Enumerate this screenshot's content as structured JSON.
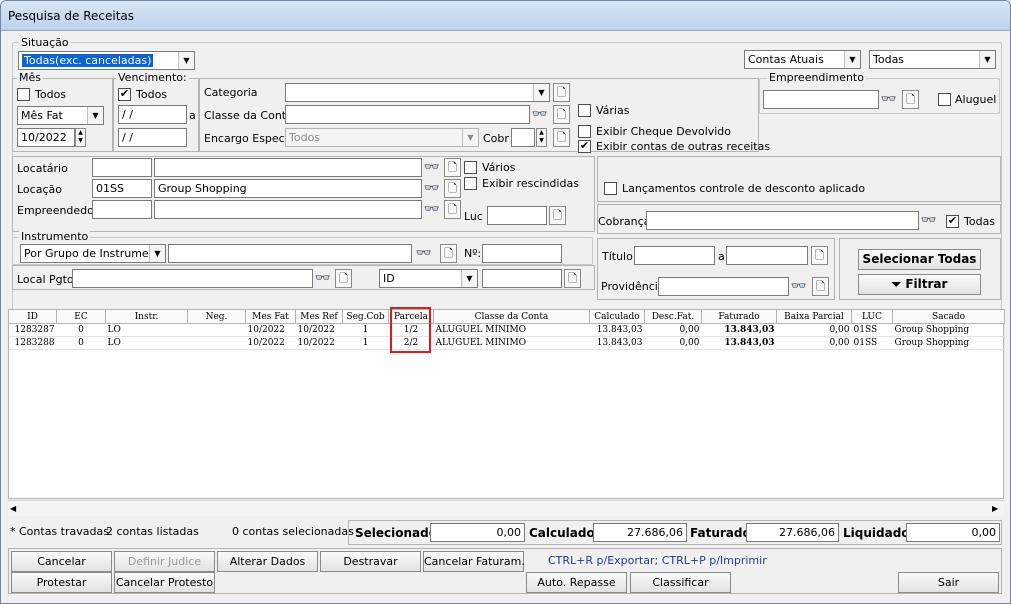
{
  "window": {
    "title": "Pesquisa de Receitas"
  },
  "situacao": {
    "label": "Situação",
    "value": "Todas(exc. canceladas)"
  },
  "top_right": {
    "contas": "Contas Atuais",
    "todas": "Todas"
  },
  "mes": {
    "label": "Mês",
    "todos": "Todos",
    "tipo": "Mês Fat",
    "valor": "10/2022"
  },
  "vencimento": {
    "label": "Vencimento:",
    "todos": "Todos",
    "de": " / /",
    "a_label": "a",
    "ate": " / /"
  },
  "categoria": {
    "categoria_label": "Categoria",
    "classe_label": "Classe da Conta",
    "encargo_label": "Encargo Espec.",
    "encargo_value": "Todos",
    "cobr_label": "Cobr",
    "varias": "Várias",
    "exibir_cheque": "Exibir Cheque Devolvido",
    "exibir_outras": "Exibir contas de outras receitas"
  },
  "empreendimento": {
    "label": "Empreendimento",
    "aluguel": "Aluguel"
  },
  "locatario": {
    "locatario_label": "Locatário",
    "locacao_label": "Locação",
    "locacao_code": "01SS",
    "locacao_name": "Group Shopping",
    "empreendedor_label": "Empreendedor",
    "varios": "Vários",
    "exibir_rescindidas": "Exibir rescindidas",
    "luc_label": "Luc"
  },
  "lancamentos": {
    "label": "Lançamentos controle de desconto aplicado"
  },
  "cobranca": {
    "label": "Cobrança",
    "todas": "Todas"
  },
  "instrumento": {
    "label": "Instrumento",
    "value": "Por Grupo de Instrumento",
    "n_label": "Nº:"
  },
  "local": {
    "label": "Local Pgto",
    "id_value": "ID"
  },
  "titulo": {
    "titulo_label": "Título",
    "a_label": "a",
    "providencia_label": "Providência"
  },
  "actions": {
    "selecionar": "Selecionar Todas",
    "filtrar": "Filtrar"
  },
  "table": {
    "headers": [
      "ID",
      "EC",
      "Instr.",
      "Neg.",
      "Mes Fat",
      "Mes Ref",
      "Seg.Cob",
      "Parcela",
      "Classe da Conta",
      "Calculado",
      "Desc.Fat.",
      "Faturado",
      "Baixa Parcial",
      "LUC",
      "Sacado"
    ],
    "rows": [
      [
        "1283287",
        "0",
        "LO",
        "",
        "10/2022",
        "10/2022",
        "1",
        "1/2",
        "ALUGUEL MÍNIMO",
        "13.843,03",
        "0,00",
        "13.843,03",
        "0,00",
        "01SS",
        "Group Shopping"
      ],
      [
        "1283288",
        "0",
        "LO",
        "",
        "10/2022",
        "10/2022",
        "1",
        "2/2",
        "ALUGUEL MÍNIMO",
        "13.843,03",
        "0,00",
        "13.843,03",
        "0,00",
        "01SS",
        "Group Shopping"
      ]
    ]
  },
  "status": {
    "travadas": "* Contas travadas",
    "listadas": "2 contas listadas",
    "selecionadas": "0 contas selecionadas",
    "selecionado_label": "Selecionado",
    "selecionado_value": "0,00",
    "calculado_label": "Calculado",
    "calculado_value": "27.686,06",
    "faturado_label": "Faturado",
    "faturado_value": "27.686,06",
    "liquidado_label": "Liquidado",
    "liquidado_value": "0,00"
  },
  "buttons": {
    "cancelar": "Cancelar",
    "definir_judice": "Definir Judice",
    "alterar_dados": "Alterar Dados",
    "destravar": "Destravar",
    "cancelar_faturam": "Cancelar Faturam.",
    "shortcuts": "CTRL+R p/Exportar; CTRL+P p/Imprimir",
    "protestar": "Protestar",
    "cancelar_protesto": "Cancelar Protesto",
    "auto_repasse": "Auto. Repasse",
    "classificar": "Classificar",
    "sair": "Sair"
  }
}
